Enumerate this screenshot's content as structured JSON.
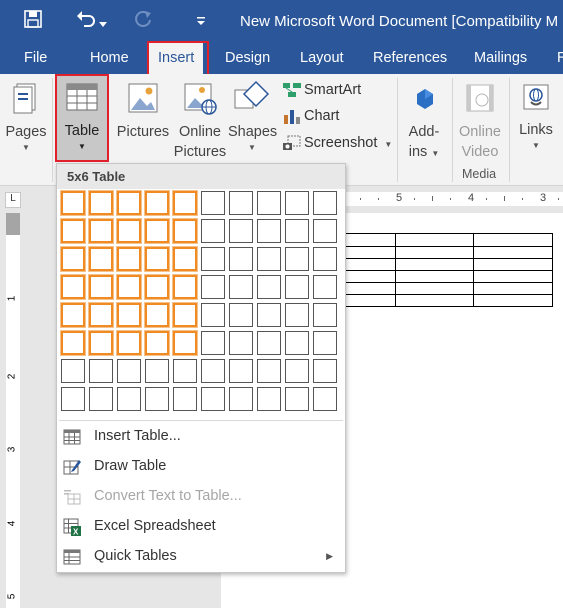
{
  "title_bar": {
    "title": "New Microsoft Word Document [Compatibility M",
    "qat": [
      "save-icon",
      "undo-icon",
      "redo-icon",
      "customize-qat-icon"
    ],
    "bg_color": "#2b579a"
  },
  "tabs": [
    {
      "label": "File",
      "active": false
    },
    {
      "label": "Home",
      "active": false
    },
    {
      "label": "Insert",
      "active": true
    },
    {
      "label": "Design",
      "active": false
    },
    {
      "label": "Layout",
      "active": false
    },
    {
      "label": "References",
      "active": false
    },
    {
      "label": "Mailings",
      "active": false
    },
    {
      "label": "R",
      "active": false
    }
  ],
  "ribbon": {
    "pages": {
      "label": "Pages",
      "icon": "pages-icon"
    },
    "table": {
      "label": "Table",
      "icon": "table-icon"
    },
    "pictures": {
      "label": "Pictures",
      "icon": "pictures-icon"
    },
    "online_pictures": {
      "label_line1": "Online",
      "label_line2": "Pictures",
      "icon": "online-pictures-icon"
    },
    "shapes": {
      "label": "Shapes",
      "icon": "shapes-icon"
    },
    "smartart": {
      "label": "SmartArt",
      "icon": "smartart-icon"
    },
    "chart": {
      "label": "Chart",
      "icon": "chart-icon"
    },
    "screenshot": {
      "label": "Screenshot",
      "icon": "screenshot-icon"
    },
    "addins": {
      "label_line1": "Add-",
      "label_line2": "ins",
      "icon": "addins-icon"
    },
    "online_video": {
      "label_line1": "Online",
      "label_line2": "Video",
      "icon": "online-video-icon",
      "enabled": false
    },
    "links": {
      "label": "Links",
      "icon": "links-icon"
    },
    "media_group_label": "Media"
  },
  "rulers": {
    "horizontal_numbers": [
      "5",
      "4",
      "3"
    ],
    "vertical_numbers": [
      "1",
      "2",
      "3",
      "4",
      "5"
    ],
    "corner_symbol": "L"
  },
  "table_dropdown": {
    "header": "5x6 Table",
    "grid_cols": 10,
    "grid_rows": 8,
    "selected_cols": 5,
    "selected_rows": 6,
    "highlight_color": "#f08a22",
    "menu": [
      {
        "label": "Insert Table...",
        "icon": "insert-table-icon",
        "enabled": true,
        "submenu": false
      },
      {
        "label": "Draw Table",
        "icon": "draw-table-icon",
        "enabled": true,
        "submenu": false
      },
      {
        "label": "Convert Text to Table...",
        "icon": "convert-text-to-table-icon",
        "enabled": false,
        "submenu": false
      },
      {
        "label": "Excel Spreadsheet",
        "icon": "excel-spreadsheet-icon",
        "enabled": true,
        "submenu": false
      },
      {
        "label": "Quick Tables",
        "icon": "quick-tables-icon",
        "enabled": true,
        "submenu": true
      }
    ]
  },
  "document_preview_table": {
    "rows": 6,
    "cols": 5
  }
}
